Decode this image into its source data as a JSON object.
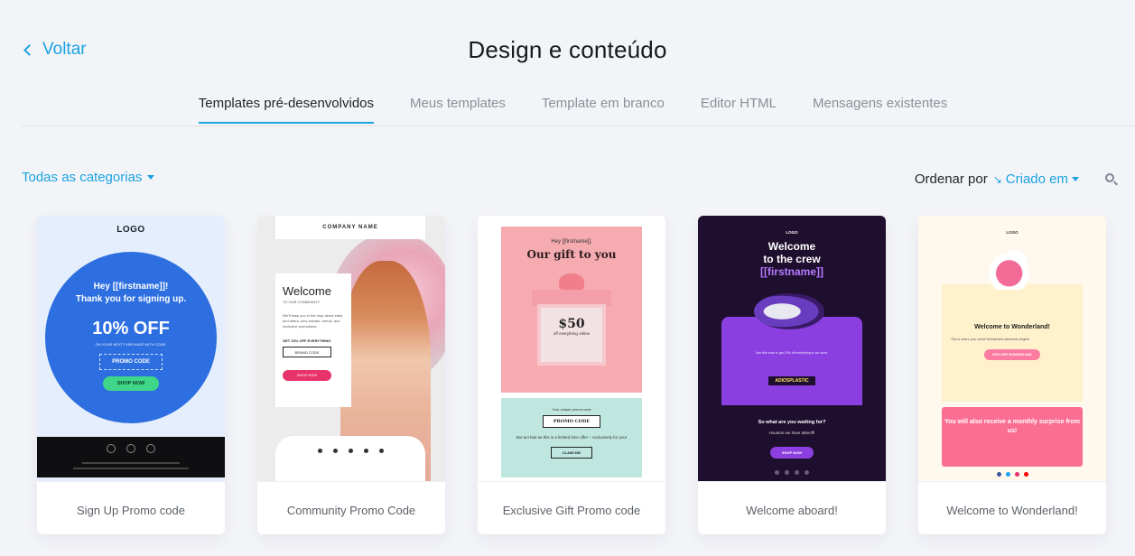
{
  "header": {
    "back_label": "Voltar",
    "title": "Design e conteúdo"
  },
  "tabs": [
    {
      "label": "Templates pré-desenvolvidos",
      "active": true
    },
    {
      "label": "Meus templates",
      "active": false
    },
    {
      "label": "Template em branco",
      "active": false
    },
    {
      "label": "Editor HTML",
      "active": false
    },
    {
      "label": "Mensagens existentes",
      "active": false
    }
  ],
  "filters": {
    "category_label": "Todas as categorias",
    "sort_label": "Ordenar por",
    "sort_value": "Criado em"
  },
  "templates": [
    {
      "name": "Sign Up Promo code",
      "preview": {
        "logo": "LOGO",
        "greeting_line1": "Hey [[firstname]]!",
        "greeting_line2": "Thank you for signing up.",
        "discount": "10% OFF",
        "discount_sub": "ON YOUR NEXT PURCHASE WITH CODE:",
        "code": "PROMO CODE",
        "button": "SHOP NOW"
      }
    },
    {
      "name": "Community Promo Code",
      "preview": {
        "company": "COMPANY NAME",
        "welcome": "Welcome",
        "subtitle": "TO OUR COMMUNITY",
        "body": "We'll keep you in the loop about early bird offers, new arrivals, trends, and exclusive promotions.",
        "offer": "GET 10% OFF EVERYTHING",
        "code": "BRAND CODE",
        "button": "SHOP NOW"
      }
    },
    {
      "name": "Exclusive Gift Promo code",
      "preview": {
        "greeting": "Hey [[firstname]],",
        "headline": "Our gift to you",
        "price": "$50",
        "price_sub": "off everything online",
        "code_intro": "Your unique promo code",
        "code": "PROMO CODE",
        "act_line": "But act fast as this is a limited time offer – exclusively for you!",
        "button": "CLAIM $50"
      }
    },
    {
      "name": "Welcome aboard!",
      "preview": {
        "logo": "LOGO",
        "welcome_1": "Welcome",
        "welcome_2": "to the crew",
        "welcome_3": "[[firstname]]",
        "body": "Use this code to get 10% off everything in our store.",
        "code": "ADIOSPLASTIC",
        "waiting": "So what are you waiting for?",
        "houston": "Houston we have takeoff!",
        "button": "SHOP NOW"
      }
    },
    {
      "name": "Welcome to Wonderland!",
      "preview": {
        "logo": "LOGO",
        "title": "Welcome to Wonderland!",
        "body": "This is where your whole Wonderland adventure begins!",
        "button": "EXPLORE WONDERLAND",
        "surprise": "You will also receive a monthly surprise from us!"
      }
    }
  ],
  "colors": {
    "accent": "#1aa3e1",
    "background": "#f3f4f8"
  }
}
